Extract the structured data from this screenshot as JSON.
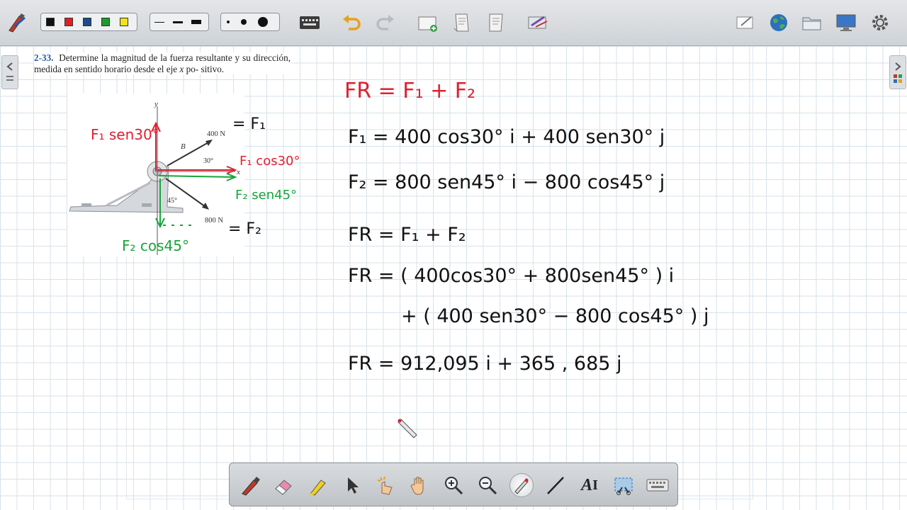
{
  "toolbar": {
    "colors": [
      "#111111",
      "#e01e25",
      "#1c4c8c",
      "#1f9a2e",
      "#f3e21b"
    ],
    "line_widths": [
      "thin",
      "medium",
      "thick"
    ],
    "dot_sizes": [
      "small",
      "medium",
      "large"
    ],
    "icons": [
      "pen-settings-icon",
      "keyboard-icon",
      "undo-icon",
      "redo-icon",
      "new-page-icon",
      "previous-page-icon",
      "next-page-icon",
      "page-sorter-icon",
      "notebook-icon",
      "globe-icon",
      "folder-icon",
      "screen-icon",
      "settings-icon"
    ]
  },
  "problem": {
    "number": "2-33.",
    "text_line1": "Determine la magnitud de la fuerza resultante y",
    "text_line2": "su dirección, medida en sentido horario desde el eje",
    "axis_var": "x",
    "text_line2_end": "po-",
    "text_line3": "sitivo."
  },
  "figure": {
    "axis_y": "y",
    "axis_x": "x",
    "label_B": "B",
    "force1": "400 N",
    "force2": "800 N",
    "angle1": "30°",
    "angle2": "45°"
  },
  "annotations": {
    "f1_sen": "F₁ sen30°",
    "eq_f1": "= F₁",
    "f1_cos": "F₁ cos30°",
    "f2_sen": "F₂ sen45°",
    "eq_f2": "= F₂",
    "f2_cos": "F₂ cos45°"
  },
  "equations": {
    "line1": "FR = F₁ + F₂",
    "line2": "F₁ = 400 cos30° i + 400 sen30° j",
    "line3": "F₂ = 800 sen45° i − 800 cos45° j",
    "line4": "FR = F₁ + F₂",
    "line5": "FR = ( 400cos30° + 800sen45° ) i",
    "line6": "+ ( 400 sen30° − 800 cos45° ) j",
    "line7": "FR = 912,095 i + 365 , 685 j"
  },
  "bottom_tools": [
    {
      "name": "pen-tool-icon"
    },
    {
      "name": "eraser-tool-icon"
    },
    {
      "name": "highlighter-tool-icon"
    },
    {
      "name": "select-tool-icon"
    },
    {
      "name": "magic-touch-tool-icon"
    },
    {
      "name": "pan-hand-tool-icon"
    },
    {
      "name": "zoom-in-tool-icon"
    },
    {
      "name": "zoom-out-tool-icon"
    },
    {
      "name": "laser-pen-tool-icon",
      "active": true
    },
    {
      "name": "line-tool-icon"
    },
    {
      "name": "text-tool-icon",
      "label": "A"
    },
    {
      "name": "screen-capture-tool-icon"
    },
    {
      "name": "keyboard-tool-icon"
    }
  ]
}
